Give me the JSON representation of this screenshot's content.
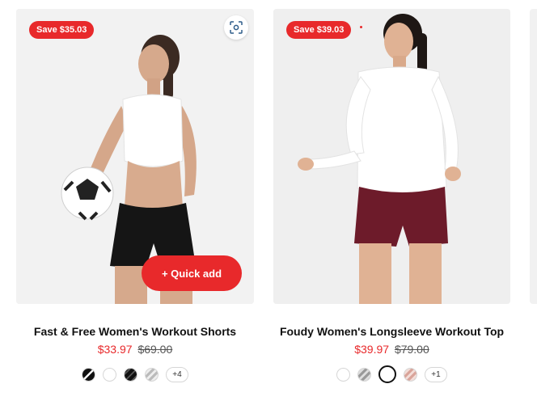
{
  "products": [
    {
      "badge": "Save $35.03",
      "title": "Fast & Free Women's Workout Shorts",
      "price_sale": "$33.97",
      "price_compare": "$69.00",
      "quick_add_label": "+ Quick add",
      "more_swatches": "+4",
      "swatches": [
        "black-white-stripe",
        "white",
        "black-pattern",
        "grey-pattern"
      ]
    },
    {
      "badge": "Save $39.03",
      "title": "Foudy Women's Longsleeve Workout Top",
      "price_sale": "$39.97",
      "price_compare": "$79.00",
      "more_swatches": "+1",
      "swatches": [
        "white",
        "grey-stripe",
        "black",
        "pink-stripe"
      ]
    }
  ],
  "colors": {
    "accent": "#e8292b",
    "text": "#111111"
  },
  "icons": {
    "visual_search": "lens-scan-icon"
  }
}
